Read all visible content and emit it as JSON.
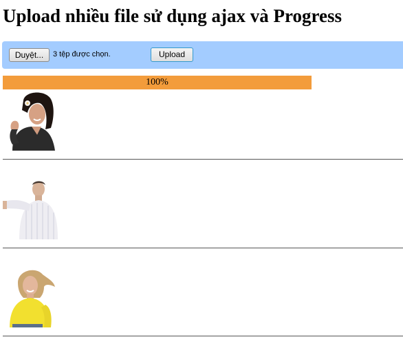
{
  "page": {
    "title": "Upload nhiều file sử dụng ajax và Progress"
  },
  "upload_form": {
    "browse_label": "Duyệt...",
    "file_status": "3 tệp được chọn.",
    "upload_label": "Upload",
    "bar_color": "#a3ccff"
  },
  "progress": {
    "value": 100,
    "label": "100%",
    "color": "#f39c3b"
  },
  "uploaded_images": [
    {
      "subject": "woman-dark-hair-phone-gesture"
    },
    {
      "subject": "man-white-shirt"
    },
    {
      "subject": "woman-yellow-shirt"
    }
  ]
}
